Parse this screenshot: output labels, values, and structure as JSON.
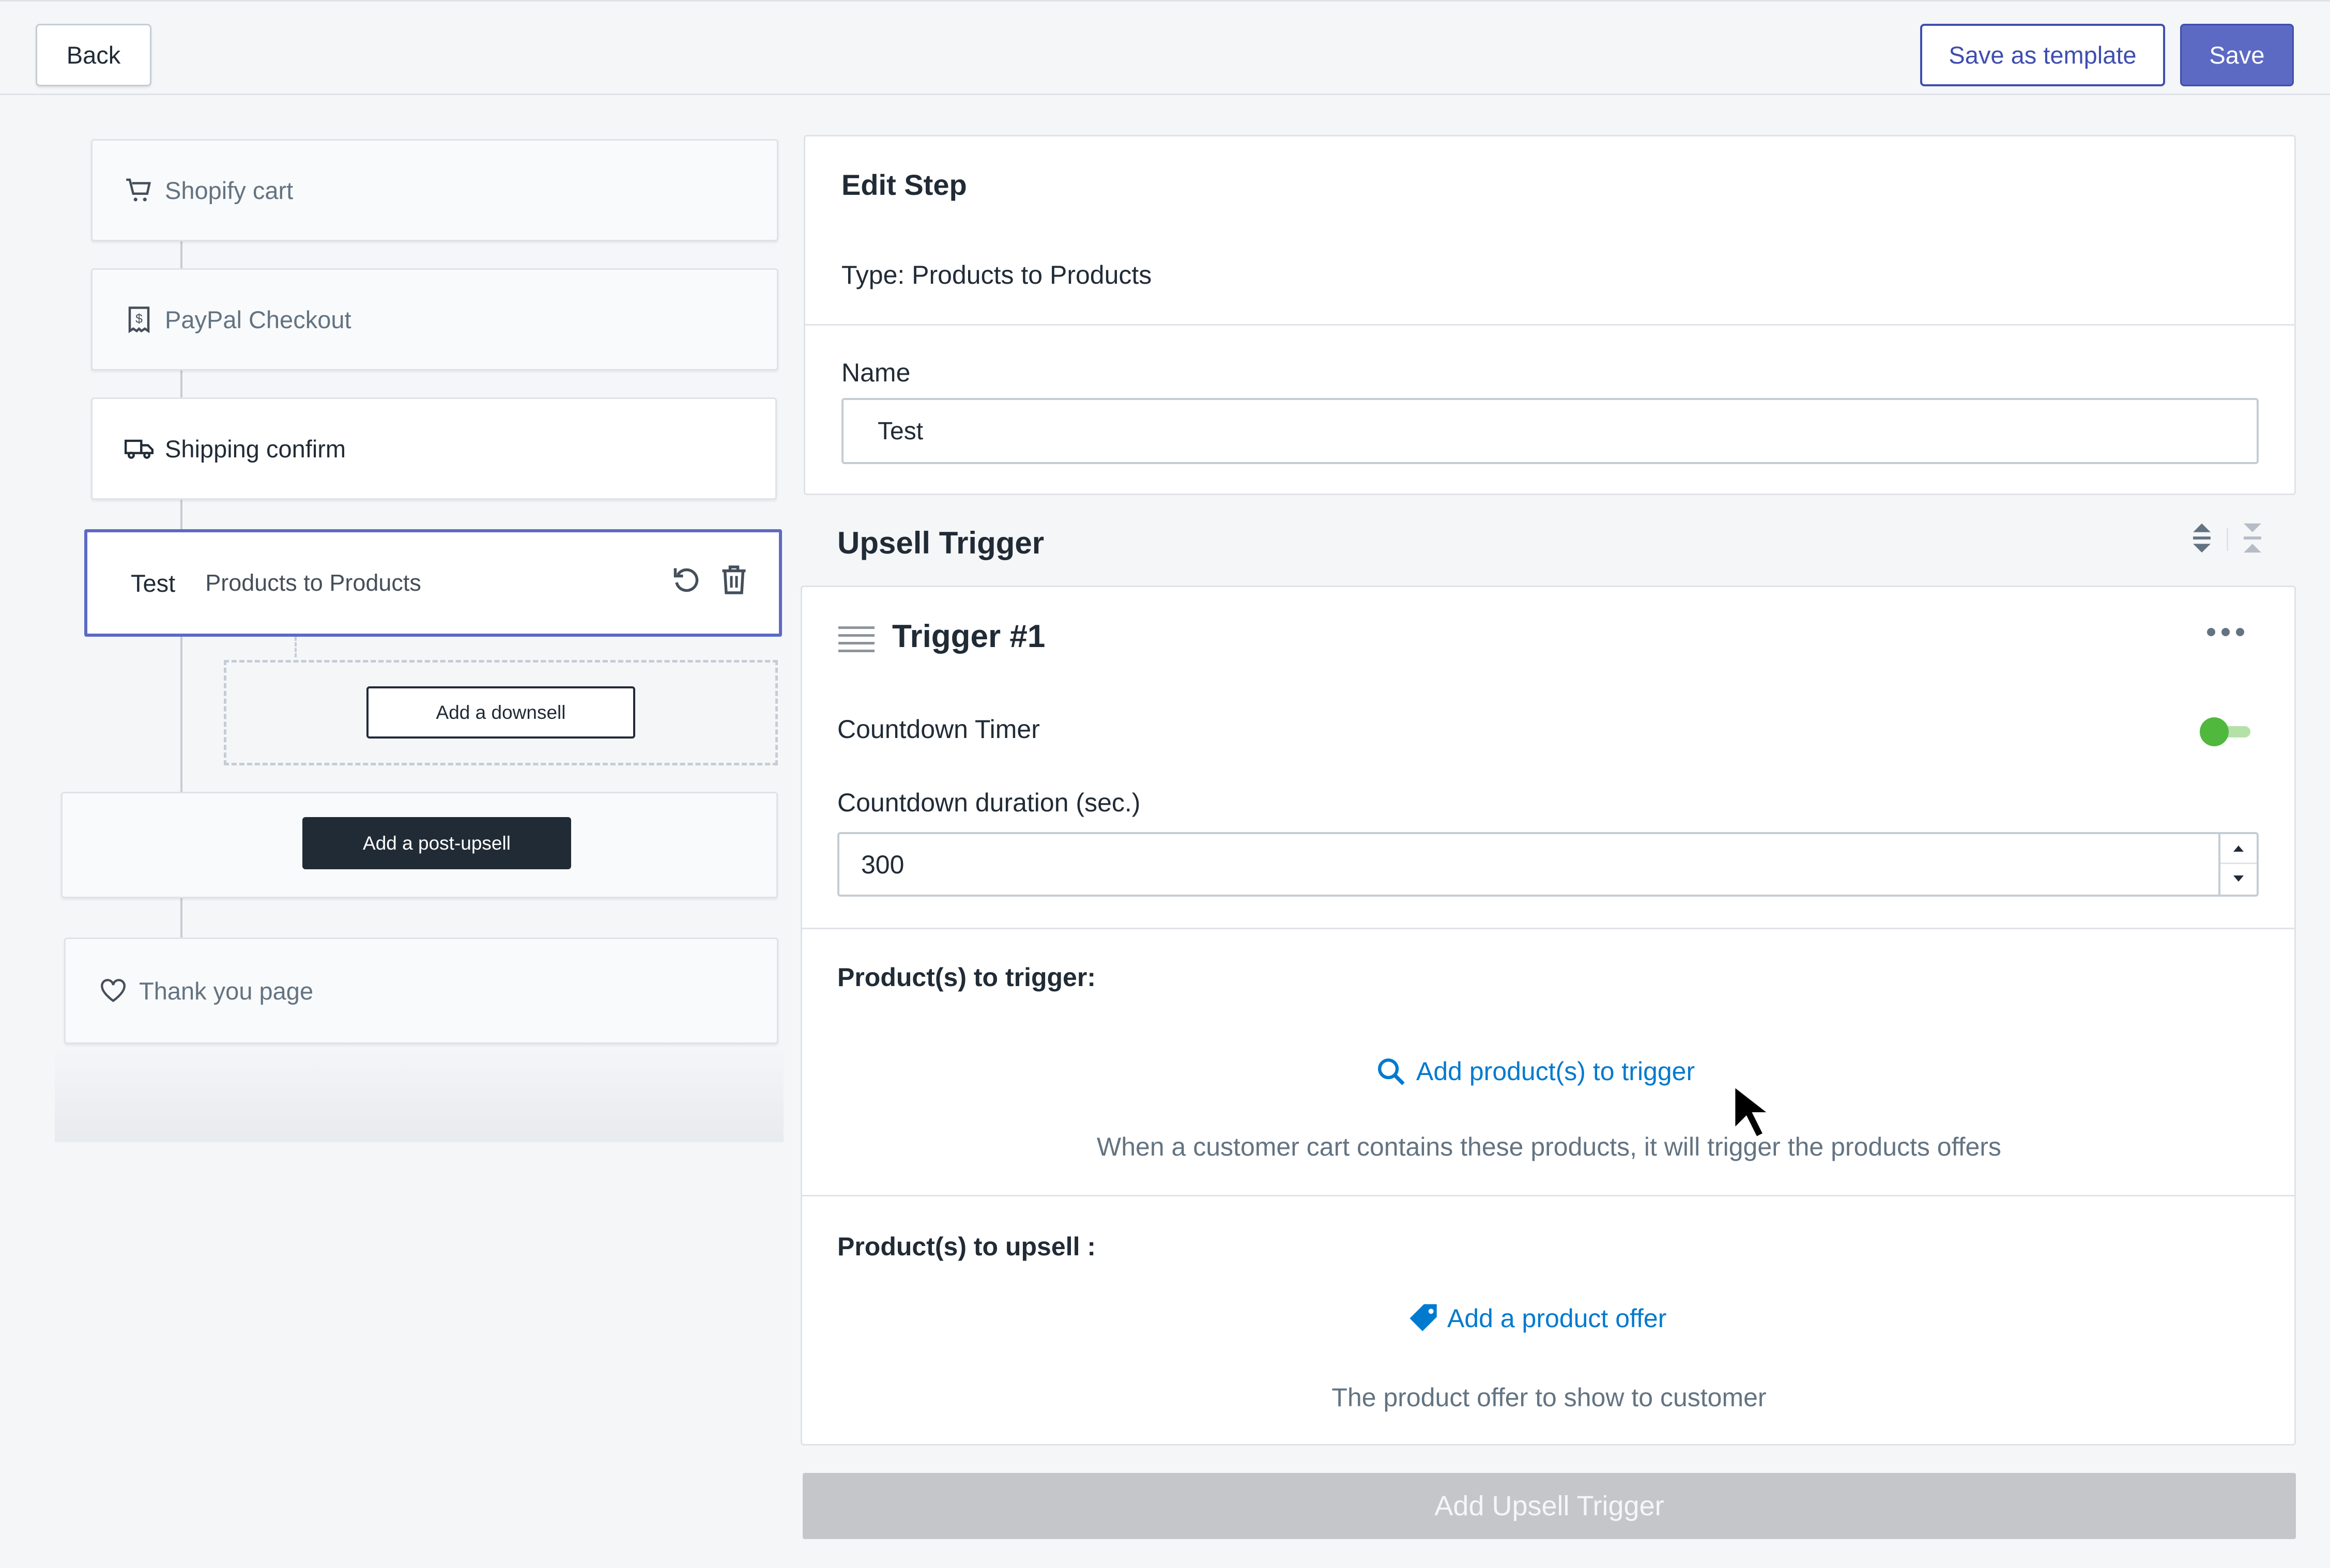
{
  "header": {
    "back_label": "Back",
    "save_template_label": "Save as template",
    "save_label": "Save"
  },
  "flow": {
    "steps": [
      {
        "label": "Shopify cart",
        "icon": "cart-icon"
      },
      {
        "label": "PayPal Checkout",
        "icon": "receipt-icon"
      },
      {
        "label": "Shipping confirm",
        "icon": "truck-icon"
      }
    ],
    "selected": {
      "name": "Test",
      "type": "Products to Products"
    },
    "add_downsell_label": "Add a downsell",
    "add_post_upsell_label": "Add a post-upsell",
    "thank_you_label": "Thank you page"
  },
  "edit_step": {
    "title": "Edit Step",
    "type_text": "Type: Products to Products",
    "name_label": "Name",
    "name_value": "Test"
  },
  "upsell": {
    "section_title": "Upsell Trigger",
    "trigger_title": "Trigger #1",
    "countdown_label": "Countdown Timer",
    "countdown_on": true,
    "duration_label": "Countdown duration (sec.)",
    "duration_value": "300",
    "trigger_products_label": "Product(s) to trigger:",
    "add_trigger_link": "Add product(s) to trigger",
    "trigger_help": "When a customer cart contains these products, it will trigger the products offers",
    "upsell_products_label": "Product(s) to upsell :",
    "add_offer_link": "Add a product offer",
    "offer_help": "The product offer to show to customer",
    "add_trigger_button": "Add Upsell Trigger"
  },
  "colors": {
    "accent": "#5c6ac4",
    "accent_dark": "#3f4eae",
    "link": "#007ace",
    "toggle_on": "#50b83c",
    "disabled_button": "#c4c6c9"
  }
}
